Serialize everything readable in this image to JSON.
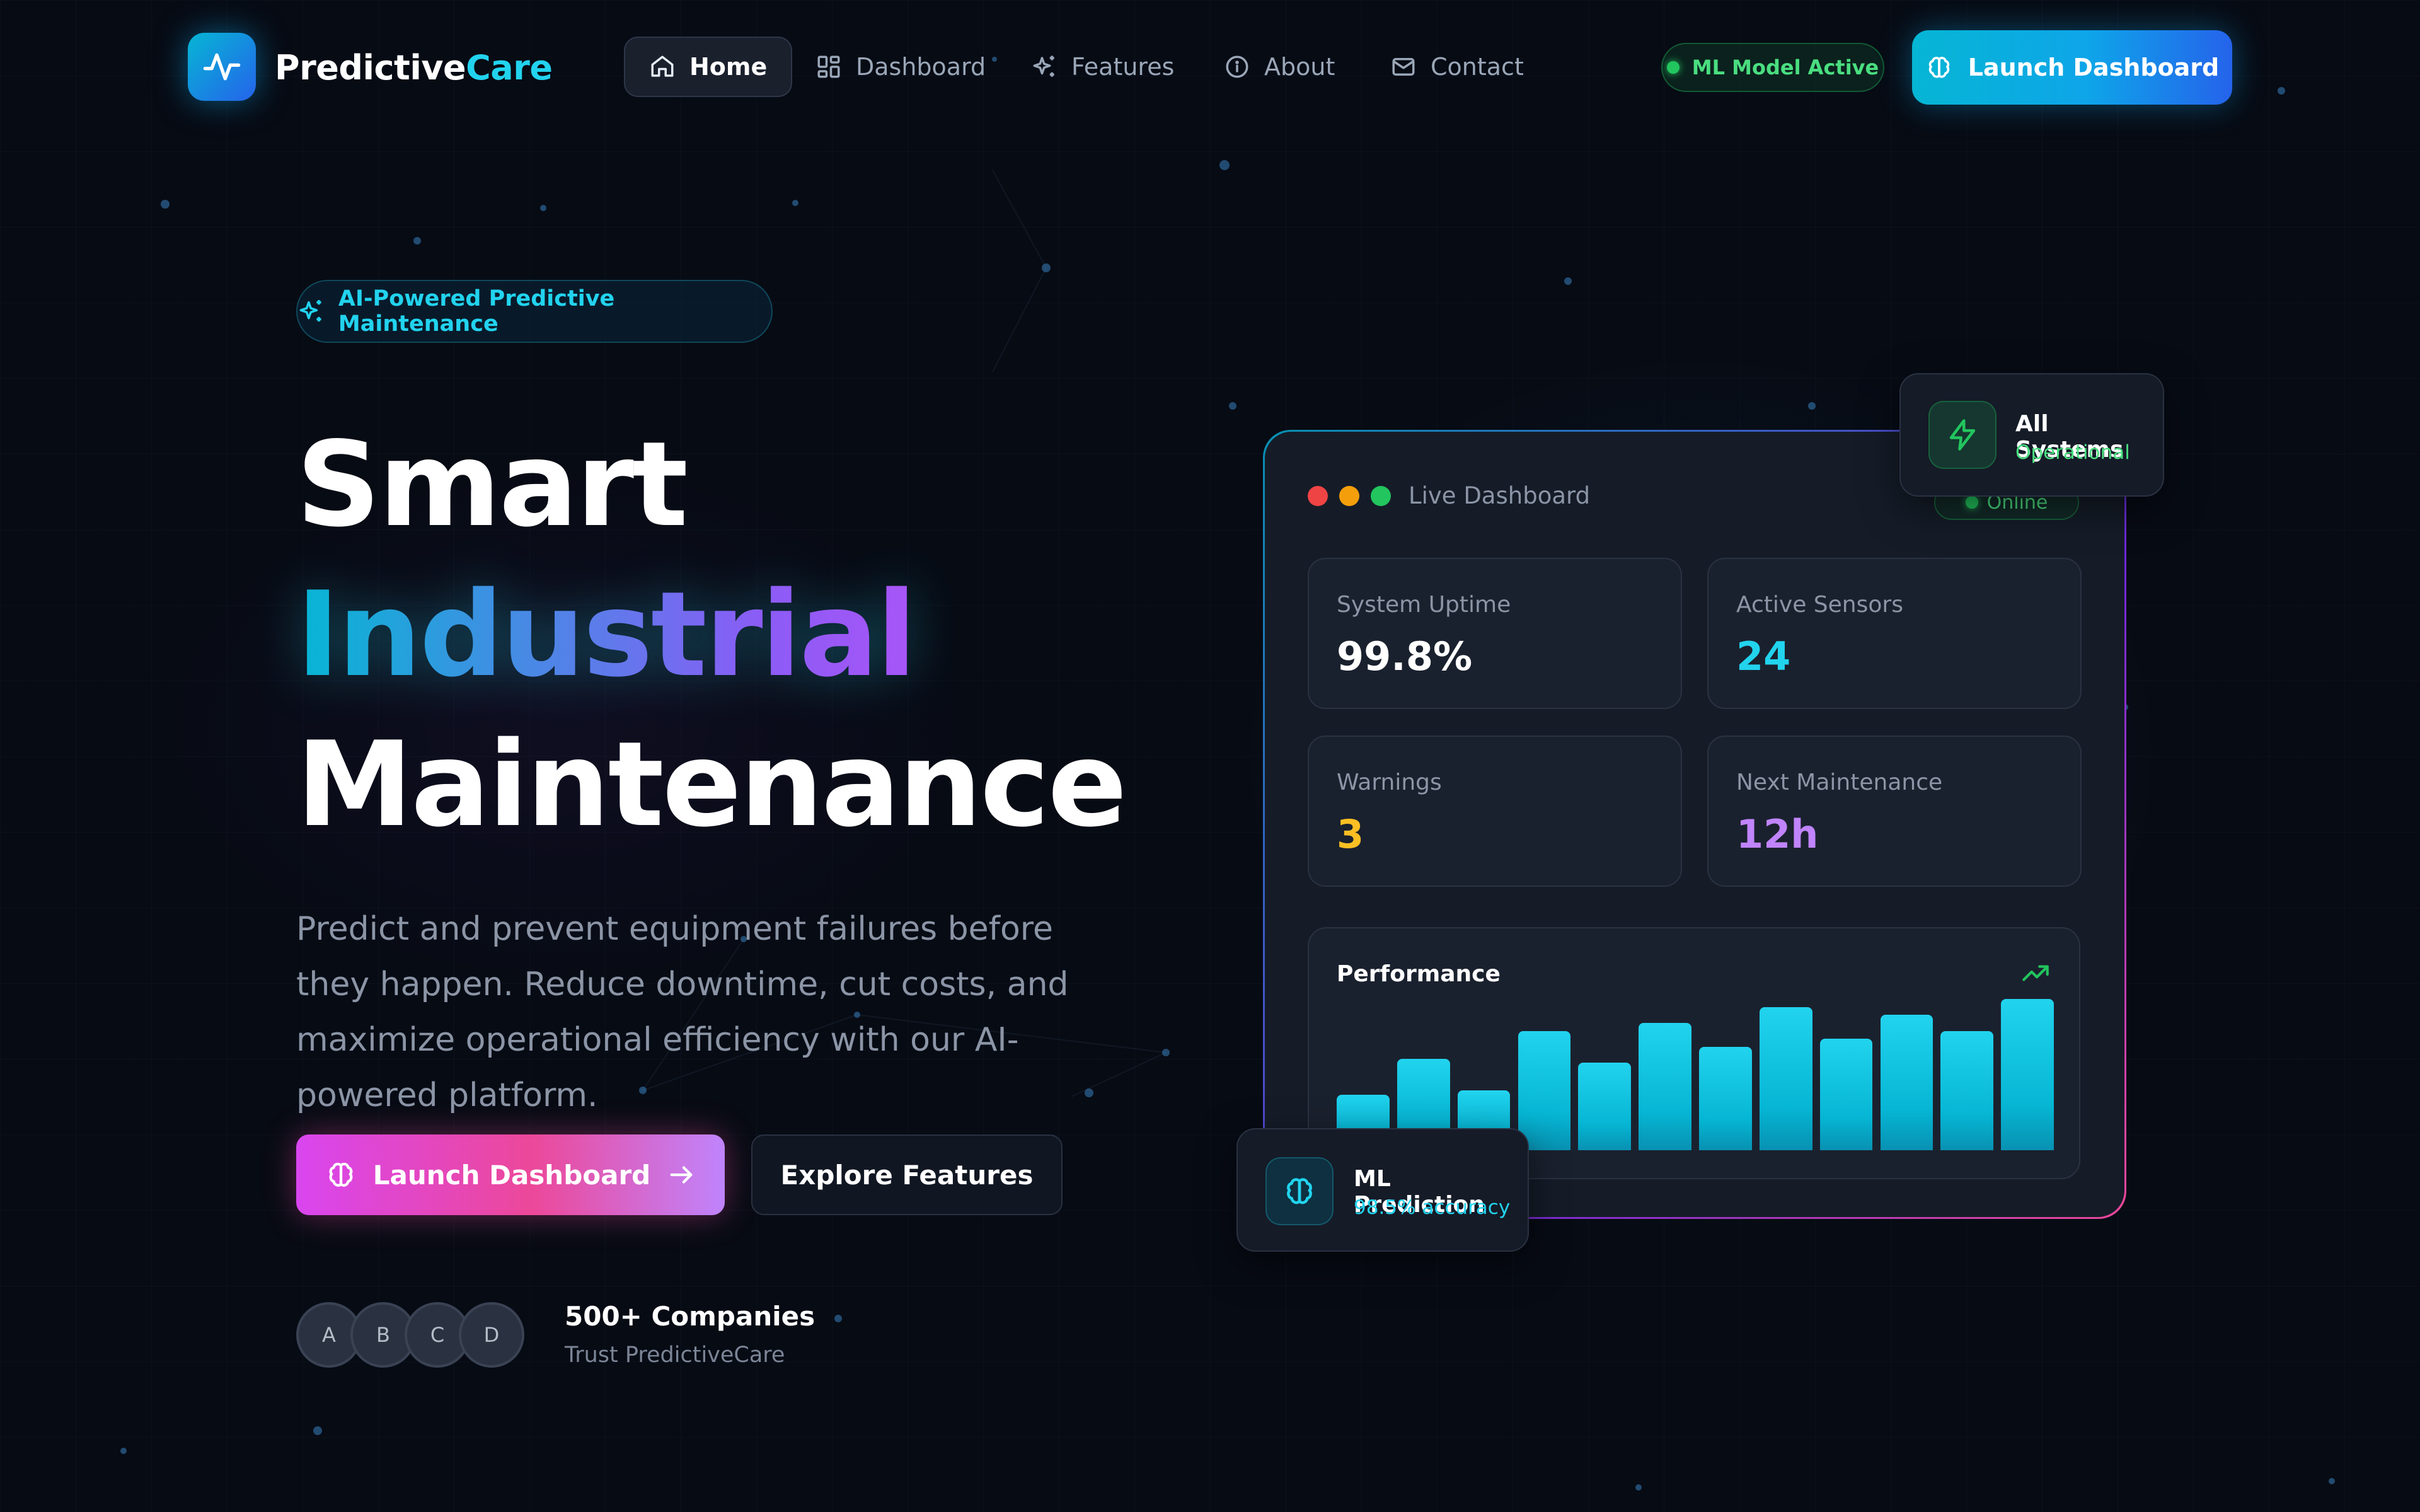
{
  "brand": {
    "name_part1": "Predictive",
    "name_part2": "Care",
    "logo_icon": "activity-pulse-icon"
  },
  "nav": {
    "items": [
      {
        "label": "Home",
        "icon": "home-icon",
        "active": true
      },
      {
        "label": "Dashboard",
        "icon": "grid-icon",
        "active": false
      },
      {
        "label": "Features",
        "icon": "sparkles-icon",
        "active": false
      },
      {
        "label": "About",
        "icon": "info-icon",
        "active": false
      },
      {
        "label": "Contact",
        "icon": "mail-icon",
        "active": false
      }
    ],
    "status_pill": "ML Model Active",
    "cta": "Launch Dashboard"
  },
  "hero": {
    "badge": "AI-Powered Predictive Maintenance",
    "title_line1": "Smart",
    "title_line2": "Industrial",
    "title_line3": "Maintenance",
    "description": "Predict and prevent equipment failures before they happen. Reduce downtime, cut costs, and maximize operational efficiency with our AI-powered platform.",
    "primary_button": "Launch Dashboard",
    "secondary_button": "Explore Features",
    "avatars": [
      "A",
      "B",
      "C",
      "D"
    ],
    "companies": "500+ Companies",
    "trust": "Trust PredictiveCare"
  },
  "dashboard": {
    "title": "Live Dashboard",
    "status": "Online",
    "stats": [
      {
        "label": "System Uptime",
        "value": "99.8%",
        "color": "#ffffff"
      },
      {
        "label": "Active Sensors",
        "value": "24",
        "color": "#22d3ee"
      },
      {
        "label": "Warnings",
        "value": "3",
        "color": "#fbbf24"
      },
      {
        "label": "Next Maintenance",
        "value": "12h",
        "color": "#c084fc"
      }
    ],
    "performance_title": "Performance",
    "performance_bars": [
      0.28,
      0.46,
      0.3,
      0.6,
      0.44,
      0.64,
      0.52,
      0.72,
      0.56,
      0.68,
      0.6,
      0.76
    ]
  },
  "floating_system": {
    "title": "All Systems",
    "subtitle": "Operational",
    "icon": "zap-icon"
  },
  "floating_ml": {
    "title": "ML Prediction",
    "subtitle": "98.5% accuracy",
    "icon": "brain-icon"
  },
  "colors": {
    "accent_cyan": "#22d3ee",
    "accent_pink": "#ec4899",
    "success": "#22c55e",
    "background": "#070b14"
  }
}
